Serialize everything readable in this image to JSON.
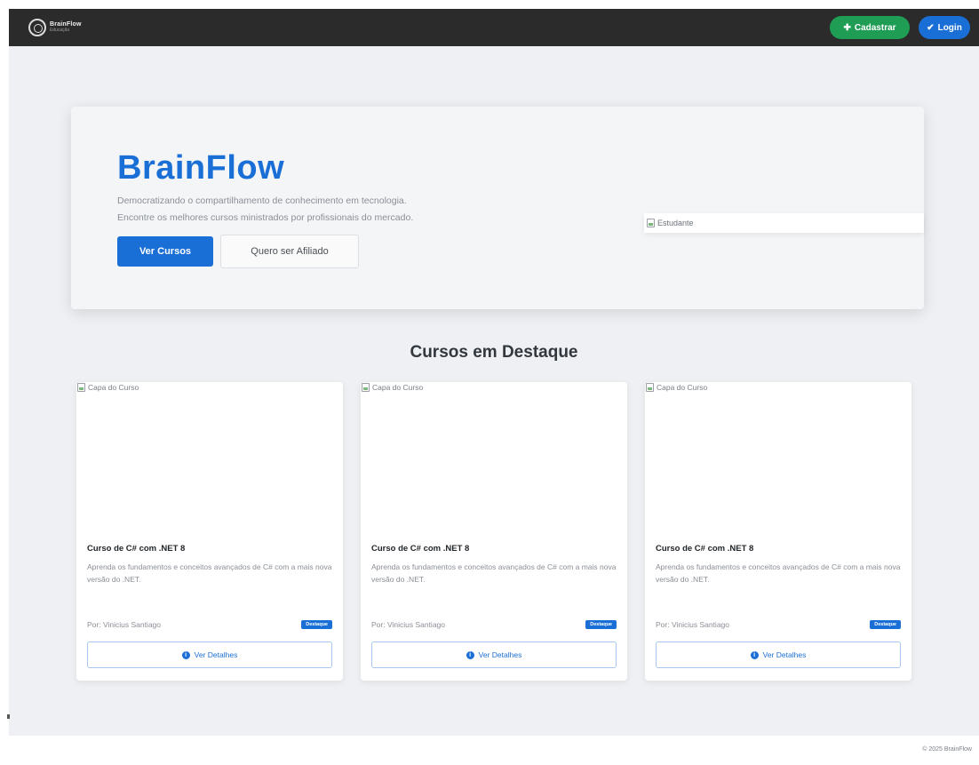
{
  "navbar": {
    "brand_name": "BrainFlow",
    "brand_sub": "Educação",
    "cadastrar_label": "Cadastrar",
    "login_label": "Login"
  },
  "hero": {
    "title": "BrainFlow",
    "desc_line1": "Democratizando o compartilhamento de conhecimento em tecnologia.",
    "desc_line2": "Encontre os melhores cursos ministrados por profissionais do mercado.",
    "primary_button": "Ver Cursos",
    "secondary_button": "Quero ser Afiliado",
    "image_alt": "Estudante"
  },
  "featured": {
    "section_title": "Cursos em Destaque",
    "cards": [
      {
        "cover_alt": "Capa do Curso",
        "title": "Curso de C# com .NET 8",
        "description": "Aprenda os fundamentos e conceitos avançados de C# com a mais nova versão do .NET.",
        "author": "Por: Vinicius Santiago",
        "badge": "Destaque",
        "button": "Ver Detalhes"
      },
      {
        "cover_alt": "Capa do Curso",
        "title": "Curso de C# com .NET 8",
        "description": "Aprenda os fundamentos e conceitos avançados de C# com a mais nova versão do .NET.",
        "author": "Por: Vinicius Santiago",
        "badge": "Destaque",
        "button": "Ver Detalhes"
      },
      {
        "cover_alt": "Capa do Curso",
        "title": "Curso de C# com .NET 8",
        "description": "Aprenda os fundamentos e conceitos avançados de C# com a mais nova versão do .NET.",
        "author": "Por: Vinicius Santiago",
        "badge": "Destaque",
        "button": "Ver Detalhes"
      }
    ]
  },
  "footer": {
    "text": "© 2025 BrainFlow"
  },
  "colors": {
    "primary": "#1a6fd6",
    "success": "#1f9d55",
    "navbar": "#2b2b2b",
    "background": "#eef0f3"
  },
  "icons": {
    "cadastrar": "plus-icon",
    "login": "check-icon",
    "details": "info-icon",
    "broken_image": "broken-image-icon"
  }
}
